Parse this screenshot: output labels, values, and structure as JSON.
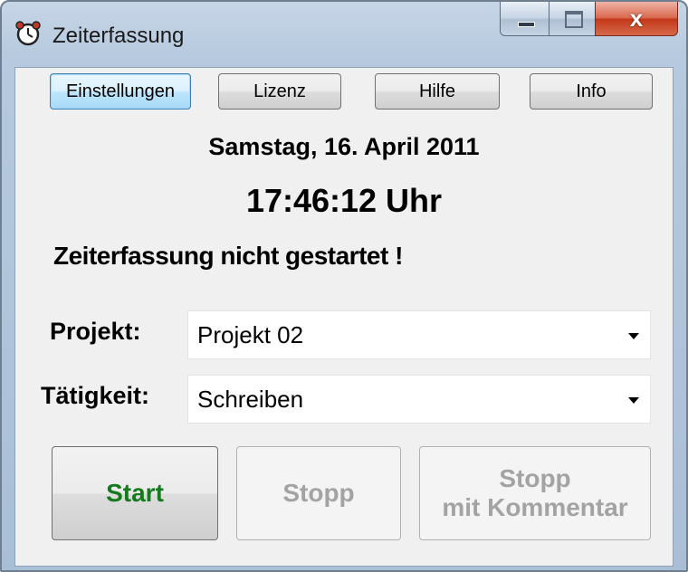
{
  "window": {
    "title": "Zeiterfassung",
    "icon": "alarm-clock-icon",
    "controls": {
      "minimize": "minimize-icon",
      "maximize": "maximize-icon",
      "close": "close-icon",
      "close_glyph": "x"
    }
  },
  "toolbar": {
    "settings_label": "Einstellungen",
    "license_label": "Lizenz",
    "help_label": "Hilfe",
    "info_label": "Info"
  },
  "date_text": "Samstag, 16. April 2011",
  "time_text": "17:46:12 Uhr",
  "status_text": "Zeiterfassung nicht gestartet !",
  "project": {
    "label": "Projekt:",
    "value": "Projekt 02"
  },
  "activity": {
    "label": "Tätigkeit:",
    "value": "Schreiben"
  },
  "actions": {
    "start_label": "Start",
    "stop_label": "Stopp",
    "stop_comment_line1": "Stopp",
    "stop_comment_line2": "mit Kommentar"
  },
  "colors": {
    "start_text": "#157a1e",
    "disabled_text": "#a3a3a3",
    "frame": "#b6c9de"
  }
}
